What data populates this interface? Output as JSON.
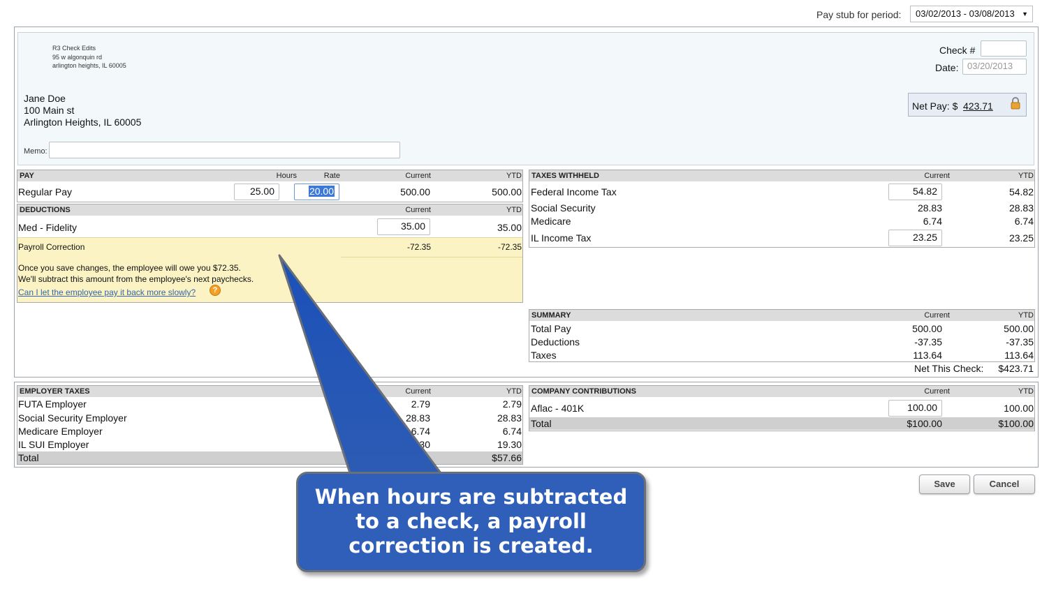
{
  "period": {
    "label": "Pay stub for period:",
    "value": "03/02/2013 - 03/08/2013"
  },
  "company": {
    "name": "R3 Check Edits",
    "address1": "95 w algonquin rd",
    "address2": "arlington heights, IL 60005"
  },
  "employee": {
    "name": "Jane Doe",
    "address1": "100 Main st",
    "address2": "Arlington Heights, IL 60005"
  },
  "check": {
    "number_label": "Check #",
    "number_value": "",
    "date_label": "Date:",
    "date_value": "03/20/2013"
  },
  "net_pay": {
    "label": "Net Pay: $",
    "value": "423.71"
  },
  "memo": {
    "label": "Memo:",
    "value": ""
  },
  "pay": {
    "header": "PAY",
    "hours_label": "Hours",
    "rate_label": "Rate",
    "current_label": "Current",
    "ytd_label": "YTD",
    "rows": [
      {
        "label": "Regular Pay",
        "hours": "25.00",
        "rate": "20.00",
        "current": "500.00",
        "ytd": "500.00"
      }
    ]
  },
  "deductions": {
    "header": "DEDUCTIONS",
    "current_label": "Current",
    "ytd_label": "YTD",
    "rows": [
      {
        "label": "Med - Fidelity",
        "current": "35.00",
        "ytd": "35.00"
      }
    ]
  },
  "correction": {
    "label": "Payroll Correction",
    "current": "-72.35",
    "ytd": "-72.35",
    "note1": "Once you save changes, the employee will owe you $72.35.",
    "note2": "We'll subtract this amount from the employee's next paychecks.",
    "link": "Can I let the employee pay it back more slowly?",
    "help": "?"
  },
  "taxes_withheld": {
    "header": "TAXES WITHHELD",
    "current_label": "Current",
    "ytd_label": "YTD",
    "rows": [
      {
        "label": "Federal Income Tax",
        "current": "54.82",
        "ytd": "54.82"
      },
      {
        "label": "Social Security",
        "current": "28.83",
        "ytd": "28.83"
      },
      {
        "label": "Medicare",
        "current": "6.74",
        "ytd": "6.74"
      },
      {
        "label": "IL Income Tax",
        "current": "23.25",
        "ytd": "23.25"
      }
    ]
  },
  "summary": {
    "header": "SUMMARY",
    "current_label": "Current",
    "ytd_label": "YTD",
    "rows": [
      {
        "label": "Total Pay",
        "current": "500.00",
        "ytd": "500.00"
      },
      {
        "label": "Deductions",
        "current": "-37.35",
        "ytd": "-37.35"
      },
      {
        "label": "Taxes",
        "current": "113.64",
        "ytd": "113.64"
      }
    ],
    "net_label": "Net This Check:",
    "net_value": "$423.71"
  },
  "employer_taxes": {
    "header": "EMPLOYER TAXES",
    "current_label": "Current",
    "ytd_label": "YTD",
    "rows": [
      {
        "label": "FUTA Employer",
        "current": "2.79",
        "ytd": "2.79"
      },
      {
        "label": "Social Security Employer",
        "current": "28.83",
        "ytd": "28.83"
      },
      {
        "label": "Medicare Employer",
        "current": "6.74",
        "ytd": "6.74"
      },
      {
        "label": "IL SUI Employer",
        "current": "19.30",
        "ytd": "19.30"
      }
    ],
    "total_label": "Total",
    "total_value": "$57.66"
  },
  "company_contributions": {
    "header": "COMPANY CONTRIBUTIONS",
    "current_label": "Current",
    "ytd_label": "YTD",
    "rows": [
      {
        "label": "Aflac - 401K",
        "current": "100.00",
        "ytd": "100.00"
      }
    ],
    "total_label": "Total",
    "total_current": "$100.00",
    "total_ytd": "$100.00"
  },
  "buttons": {
    "save": "Save",
    "cancel": "Cancel"
  },
  "callout": {
    "text": "When hours are subtracted to a check, a payroll correction is created."
  },
  "colors": {
    "callout": "#2f5fb8",
    "correction_bg": "#fbf3c4",
    "check_bg": "#f3f9fa",
    "link": "#3366aa"
  }
}
